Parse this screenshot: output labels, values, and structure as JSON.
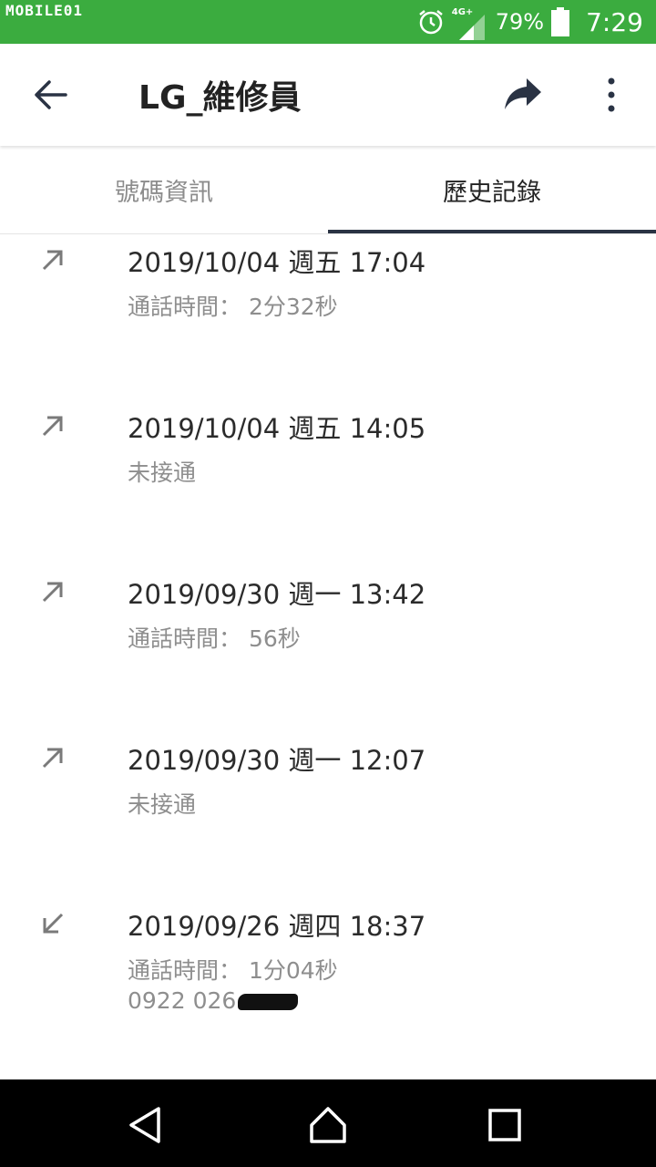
{
  "status_bar": {
    "watermark": "MOBILE01",
    "network": "4G+",
    "battery_percent": "79%",
    "time": "7:29",
    "icons": [
      "alarm-icon",
      "signal-icon",
      "battery-icon"
    ]
  },
  "app_bar": {
    "title": "LG_維修員",
    "icons": [
      "back-arrow-icon",
      "share-icon",
      "more-vert-icon"
    ]
  },
  "tabs": [
    {
      "label": "號碼資訊",
      "selected": false
    },
    {
      "label": "歷史記錄",
      "selected": true
    }
  ],
  "history": [
    {
      "direction": "outgoing",
      "datetime": "2019/10/04 週五 17:04",
      "detail": "通話時間： 2分32秒"
    },
    {
      "direction": "outgoing",
      "datetime": "2019/10/04 週五 14:05",
      "detail": "未接通"
    },
    {
      "direction": "outgoing",
      "datetime": "2019/09/30 週一 13:42",
      "detail": "通話時間： 56秒"
    },
    {
      "direction": "outgoing",
      "datetime": "2019/09/30 週一 12:07",
      "detail": "未接通"
    },
    {
      "direction": "incoming",
      "datetime": "2019/09/26 週四 18:37",
      "detail": "通話時間： 1分04秒",
      "number": "0922 026"
    }
  ],
  "nav_bar": {
    "icons": [
      "nav-back-icon",
      "nav-home-icon",
      "nav-recents-icon"
    ]
  },
  "colors": {
    "status_bar": "#3bac3f",
    "tab_indicator": "#2a3344",
    "text_secondary": "#8e8e8e"
  }
}
